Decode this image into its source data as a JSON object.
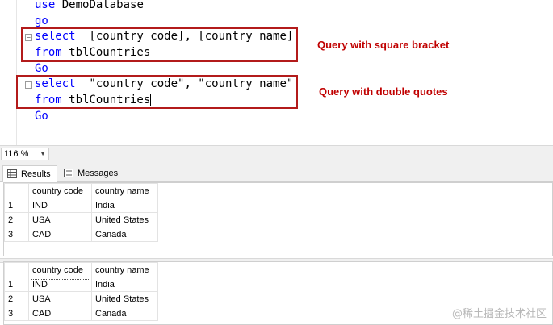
{
  "editor": {
    "lines": {
      "l1_kw": "use",
      "l1_rest": " DemoDatabase",
      "l2": "go",
      "l3_kw": "select",
      "l3_rest": "  [country code], [country name]",
      "l4_kw": "from",
      "l4_rest": " tblCountries",
      "l5": "Go",
      "l6_kw": "select",
      "l6_rest": "  \"country code\", \"country name\"",
      "l7_kw": "from",
      "l7_rest": " tblCountries",
      "l8": "Go"
    },
    "annotations": {
      "square": "Query with square bracket",
      "double": "Query with double quotes"
    },
    "annotation_color": "#c00000"
  },
  "zoom": {
    "value": "116 %"
  },
  "tabs": [
    {
      "label": "Results",
      "icon": "grid-icon",
      "active": true
    },
    {
      "label": "Messages",
      "icon": "messages-icon",
      "active": false
    }
  ],
  "grid1": {
    "headers": [
      "country code",
      "country name"
    ],
    "rows": [
      [
        "1",
        "IND",
        "India"
      ],
      [
        "2",
        "USA",
        "United States"
      ],
      [
        "3",
        "CAD",
        "Canada"
      ]
    ]
  },
  "grid2": {
    "headers": [
      "country code",
      "country name"
    ],
    "rows": [
      [
        "1",
        "IND",
        "India"
      ],
      [
        "2",
        "USA",
        "United States"
      ],
      [
        "3",
        "CAD",
        "Canada"
      ]
    ]
  },
  "watermark": "@稀土掘金技术社区",
  "colors": {
    "keyword": "#0000ff",
    "annotation_box": "#b31b1b"
  }
}
